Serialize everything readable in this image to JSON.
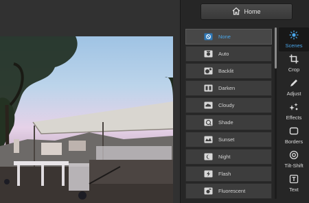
{
  "header": {
    "home_label": "Home"
  },
  "scenes": [
    {
      "label": "None",
      "icon": "none-icon",
      "selected": true
    },
    {
      "label": "Auto",
      "icon": "camera-icon"
    },
    {
      "label": "Backlit",
      "icon": "backlit-icon"
    },
    {
      "label": "Darken",
      "icon": "darken-icon"
    },
    {
      "label": "Cloudy",
      "icon": "cloud-icon"
    },
    {
      "label": "Shade",
      "icon": "shade-icon"
    },
    {
      "label": "Sunset",
      "icon": "sunset-icon"
    },
    {
      "label": "Night",
      "icon": "moon-icon"
    },
    {
      "label": "Flash",
      "icon": "flash-icon"
    },
    {
      "label": "Fluorescent",
      "icon": "fluorescent-icon"
    }
  ],
  "tools": [
    {
      "label": "Scenes",
      "icon": "scenes-sun-icon",
      "active": true
    },
    {
      "label": "Crop",
      "icon": "crop-icon"
    },
    {
      "label": "Adjust",
      "icon": "pencil-icon"
    },
    {
      "label": "Effects",
      "icon": "sparkle-icon"
    },
    {
      "label": "Borders",
      "icon": "border-icon"
    },
    {
      "label": "Tilt-Shift",
      "icon": "tiltshift-icon"
    },
    {
      "label": "Text",
      "icon": "text-icon"
    }
  ],
  "colors": {
    "accent": "#4aa6ea",
    "panel_bg": "#262626",
    "item_bg": "#3d3d3d"
  }
}
